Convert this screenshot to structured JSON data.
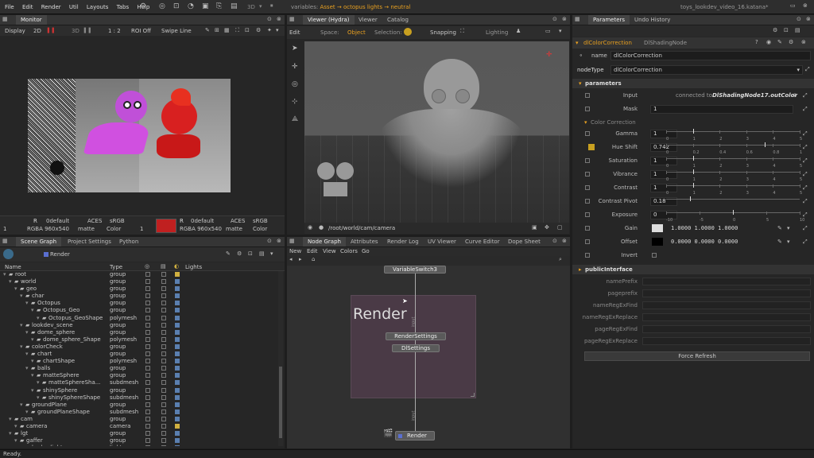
{
  "menu": [
    "File",
    "Edit",
    "Render",
    "Util",
    "Layouts",
    "Tabs",
    "Help"
  ],
  "top_toolbar": {
    "render_3d_label": "3D"
  },
  "variables": {
    "label": "variables:",
    "asset_label": "Asset",
    "asset_value": "octopus lights",
    "separator": "→",
    "value": "neutral"
  },
  "file": {
    "name": "toys_lookdev_video_16.katana*"
  },
  "colors": {
    "accent": "#e8a020",
    "selection": "#3a4a5a",
    "node_region": "#4a3a46"
  },
  "monitor": {
    "tab": "Monitor",
    "toolbar": {
      "display": "Display",
      "mode_2d": "2D",
      "mode_3d": "3D",
      "zoom": "1 : 2",
      "roi": "ROI Off",
      "swipe": "Swipe Line"
    },
    "info_left": {
      "channels": "R",
      "color": "0default",
      "space": "ACES",
      "srgb": "sRGB",
      "rgba": "RGBA 960x540",
      "matte": "matte",
      "color_label": "Color",
      "frame": "1"
    },
    "info_right": {
      "channels": "R",
      "color": "0default",
      "space": "ACES",
      "srgb": "sRGB",
      "rgba": "RGBA 960x540",
      "matte": "matte",
      "color_label": "Color",
      "frame": "1"
    }
  },
  "viewer": {
    "tabs": [
      "Viewer (Hydra)",
      "Viewer",
      "Catalog"
    ],
    "edit": "Edit",
    "space_label": "Space:",
    "space_value": "Object",
    "selection_label": "Selection:",
    "snapping": "Snapping",
    "lighting": "Lighting",
    "camera_path": "/root/world/cam/camera"
  },
  "scenegraph": {
    "tabs": [
      "Scene Graph",
      "Project Settings",
      "Python"
    ],
    "render_btn": "Render",
    "columns": {
      "name": "Name",
      "type": "Type",
      "lights": "Lights"
    },
    "rows": [
      {
        "name": "root",
        "type": "group"
      },
      {
        "name": "world",
        "type": "group"
      },
      {
        "name": "geo",
        "type": "group"
      },
      {
        "name": "char",
        "type": "group"
      },
      {
        "name": "Octopus",
        "type": "group"
      },
      {
        "name": "Octopus_Geo",
        "type": "group"
      },
      {
        "name": "Octopus_GeoShape",
        "type": "polymesh"
      },
      {
        "name": "lookdev_scene",
        "type": "group"
      },
      {
        "name": "dome_sphere",
        "type": "group"
      },
      {
        "name": "dome_sphere_Shape",
        "type": "polymesh"
      },
      {
        "name": "colorCheck",
        "type": "group"
      },
      {
        "name": "chart",
        "type": "group"
      },
      {
        "name": "chartShape",
        "type": "polymesh"
      },
      {
        "name": "balls",
        "type": "group"
      },
      {
        "name": "matteSphere",
        "type": "group"
      },
      {
        "name": "matteSphereSha...",
        "type": "subdmesh"
      },
      {
        "name": "shinySphere",
        "type": "group"
      },
      {
        "name": "shinySphereShape",
        "type": "subdmesh"
      },
      {
        "name": "groundPlane",
        "type": "group"
      },
      {
        "name": "groundPlaneShape",
        "type": "subdmesh"
      },
      {
        "name": "cam",
        "type": "group"
      },
      {
        "name": "camera",
        "type": "camera"
      },
      {
        "name": "lgt",
        "type": "group"
      },
      {
        "name": "gaffer",
        "type": "group"
      },
      {
        "name": "barbs_light",
        "type": "light"
      }
    ]
  },
  "nodegraph": {
    "tabs": [
      "Node Graph",
      "Attributes",
      "Render Log",
      "UV Viewer",
      "Curve Editor",
      "Dope Sheet"
    ],
    "menu": [
      "New",
      "Edit",
      "View",
      "Colors",
      "Go"
    ],
    "backdrop_title": "Render",
    "nodes": {
      "switch": "VariableSwitch3",
      "render_settings": "RenderSettings",
      "dl_settings": "DlSettings",
      "render": "Render"
    },
    "port_labels": {
      "input": "input",
      "input2": "input"
    }
  },
  "params": {
    "tabs": [
      "Parameters",
      "Undo History"
    ],
    "node_title": "dlColorCorrection",
    "node_type_badge": "DlShadingNode",
    "name_label": "name",
    "name_value": "dlColorCorrection",
    "nodetype_label": "nodeType",
    "nodetype_value": "dlColorCorrection",
    "section_parameters": "parameters",
    "input_label": "Input",
    "input_connected": "connected to",
    "input_node": "DlShadingNode17.outColor",
    "mask_label": "Mask",
    "mask_value": "1",
    "group_color": "Color Correction",
    "gamma_label": "Gamma",
    "gamma_value": "1",
    "hue_label": "Hue Shift",
    "hue_value": "0.742",
    "sat_label": "Saturation",
    "sat_value": "1",
    "vib_label": "Vibrance",
    "vib_value": "1",
    "con_label": "Contrast",
    "con_value": "1",
    "pivot_label": "Contrast Pivot",
    "pivot_value": "0.18",
    "exp_label": "Exposure",
    "exp_value": "0",
    "gain_label": "Gain",
    "gain_values": "1.0000   1.0000   1.0000",
    "offset_label": "Offset",
    "offset_values": "0.0000   0.0000   0.0000",
    "invert_label": "Invert",
    "slider_ticks_0_5": [
      "0",
      "1",
      "2",
      "3",
      "4",
      "5"
    ],
    "slider_ticks_hue": [
      "0",
      "0.2",
      "0.4",
      "0.6",
      "0.8",
      "1"
    ],
    "slider_ticks_exp": [
      "-10",
      "-5",
      "0",
      "5",
      "10"
    ],
    "section_public": "publicInterface",
    "public_fields": [
      "namePrefix",
      "pageprefix",
      "nameRegExFind",
      "nameRegExReplace",
      "pageRegExFind",
      "pageRegExReplace"
    ],
    "force_refresh": "Force Refresh"
  },
  "status": {
    "text": "Ready."
  }
}
